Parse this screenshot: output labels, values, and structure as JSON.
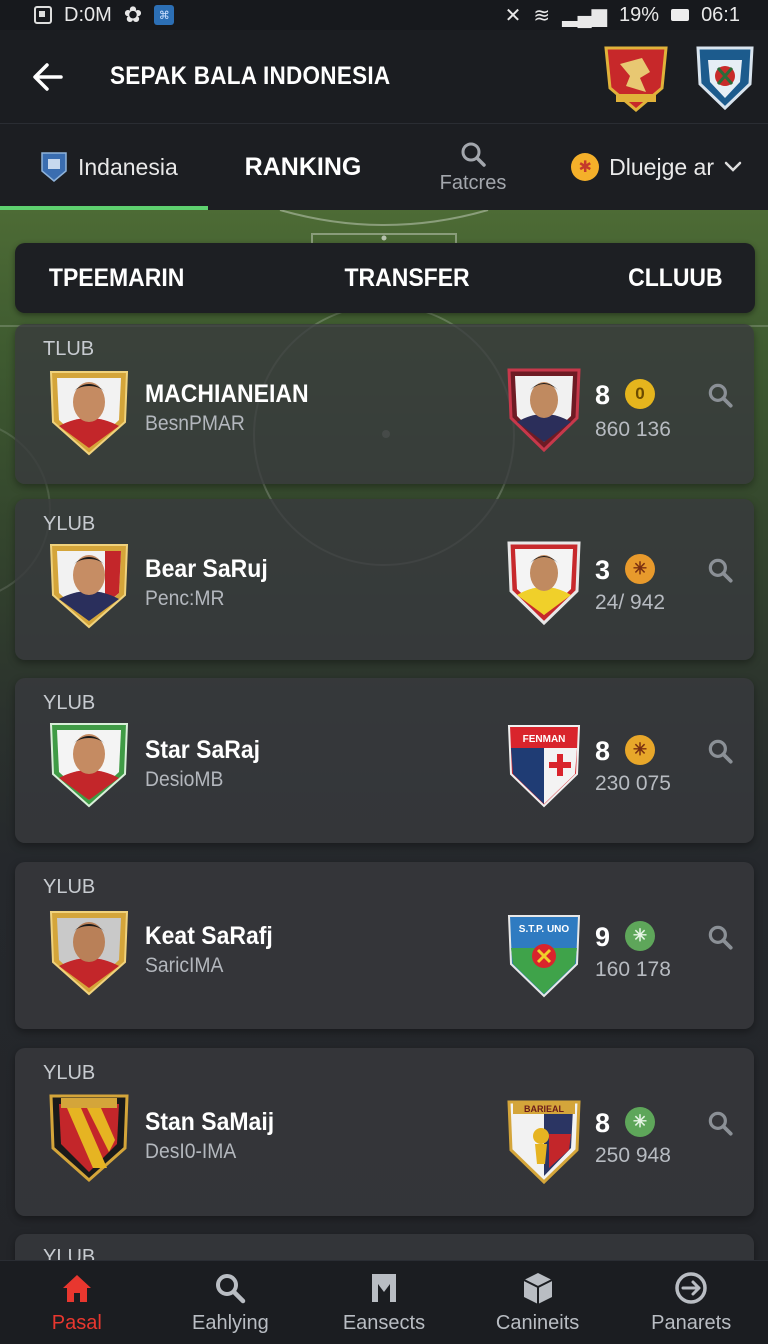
{
  "status_bar": {
    "time_left": "D:0M",
    "signal_text": "19%",
    "time_right": "06:1"
  },
  "header": {
    "title": "SEPAK BALA INDONESIA",
    "back_icon": "arrow-left-icon"
  },
  "tabs": {
    "country": "Indanesia",
    "ranking": "RANKING",
    "matches": "Fatcres",
    "league": "Dluejge ar"
  },
  "segment": {
    "left": "TPEEMARIN",
    "middle": "TRANSFER",
    "right": "CLLUUB"
  },
  "cards": [
    {
      "label": "TLUB",
      "name": "MACHIANEIAN",
      "sub": "BesnPMAR",
      "rank": "8",
      "points": "860 136",
      "badge_color": "#e5b51d",
      "badge_text": "0"
    },
    {
      "label": "YLUB",
      "name": "Bear SaRuj",
      "sub": "Penc:MR",
      "rank": "3",
      "points": "24/ 942",
      "badge_color": "#e89a2c",
      "badge_text": "✳"
    },
    {
      "label": "YLUB",
      "name": "Star SaRaj",
      "sub": "DesioMB",
      "rank": "8",
      "points": "230 075",
      "badge_color": "#e8a72a",
      "badge_text": "✳"
    },
    {
      "label": "YLUB",
      "name": "Keat SaRafj",
      "sub": "SaricIMA",
      "rank": "9",
      "points": "160 178",
      "badge_color": "#5ea65a",
      "badge_text": "✳"
    },
    {
      "label": "YLUB",
      "name": "Stan SaMaij",
      "sub": "DesI0-IMA",
      "rank": "8",
      "points": "250 948",
      "badge_color": "#5ea65a",
      "badge_text": "✳"
    },
    {
      "label": "YLUB"
    }
  ],
  "club_texts": {
    "club3": "FENMAN",
    "club4": "S.T.P. UNO",
    "club5": "BARIEAL"
  },
  "bottom_nav": [
    {
      "label": "Pasal",
      "icon": "home-icon",
      "active": true
    },
    {
      "label": "Eahlying",
      "icon": "search-icon",
      "active": false
    },
    {
      "label": "Eansects",
      "icon": "shirt-icon",
      "active": false
    },
    {
      "label": "Canineits",
      "icon": "box-icon",
      "active": false
    },
    {
      "label": "Panarets",
      "icon": "compass-icon",
      "active": false
    }
  ],
  "colors": {
    "accent_green": "#5ed16f",
    "active_red": "#e8372f",
    "background": "#1e2024"
  }
}
